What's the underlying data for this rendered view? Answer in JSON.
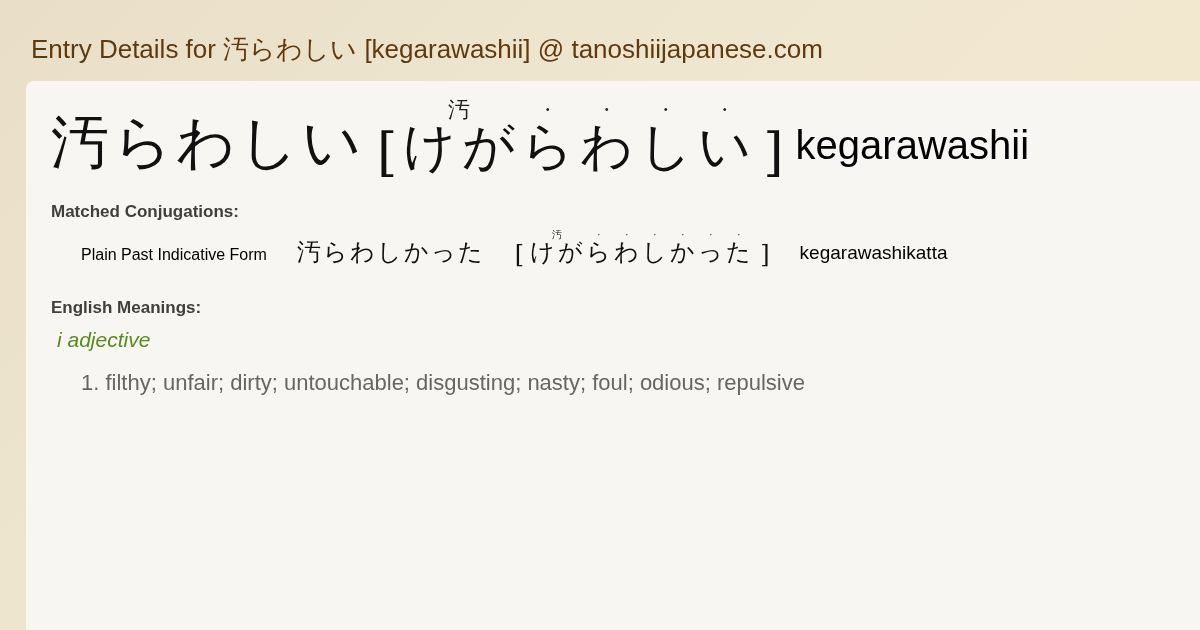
{
  "page_title": "Entry Details for 汚らわしい [kegarawashii] @ tanoshiijapanese.com",
  "brackets": {
    "open": "[",
    "close": "]"
  },
  "entry": {
    "word": "汚らわしい",
    "reading": [
      {
        "text": "けが",
        "ruby": "汚"
      },
      {
        "text": "ら",
        "ruby": "·"
      },
      {
        "text": "わ",
        "ruby": "·"
      },
      {
        "text": "し",
        "ruby": "·"
      },
      {
        "text": "い",
        "ruby": "·"
      }
    ],
    "romaji": "kegarawashii"
  },
  "conjugations": {
    "heading": "Matched Conjugations:",
    "rows": [
      {
        "form": "Plain Past Indicative Form",
        "word": "汚らわしかった",
        "reading": [
          {
            "text": "けが",
            "ruby": "汚"
          },
          {
            "text": "ら",
            "ruby": "·"
          },
          {
            "text": "わ",
            "ruby": "·"
          },
          {
            "text": "し",
            "ruby": "·"
          },
          {
            "text": "か",
            "ruby": "·"
          },
          {
            "text": "っ",
            "ruby": "·"
          },
          {
            "text": "た",
            "ruby": "·"
          }
        ],
        "romaji": "kegarawashikatta"
      }
    ]
  },
  "meanings": {
    "heading": "English Meanings:",
    "part_of_speech": "i adjective",
    "items": [
      {
        "number": "1.",
        "text": "filthy; unfair; dirty; untouchable; disgusting; nasty; foul; odious; repulsive"
      }
    ]
  }
}
